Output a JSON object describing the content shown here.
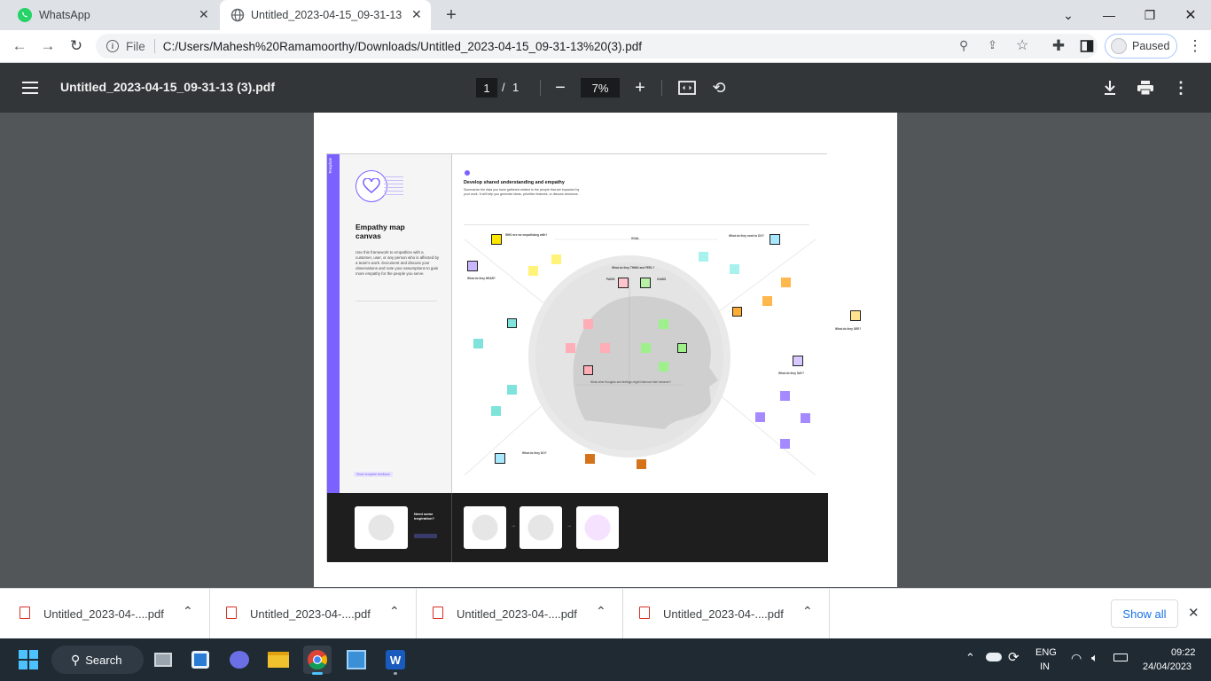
{
  "browser": {
    "tabs": [
      {
        "title": "WhatsApp",
        "icon": "whatsapp-icon"
      },
      {
        "title": "Untitled_2023-04-15_09-31-13 (3",
        "icon": "globe-icon"
      }
    ],
    "address": {
      "prefix": "File",
      "url": "C:/Users/Mahesh%20Ramamoorthy/Downloads/Untitled_2023-04-15_09-31-13%20(3).pdf"
    },
    "profile_label": "Paused"
  },
  "pdf": {
    "filename": "Untitled_2023-04-15_09-31-13 (3).pdf",
    "page_current": "1",
    "page_sep": "/",
    "page_total": "1",
    "zoom": "7%",
    "content": {
      "template_tag": "Template",
      "heading": "Empathy map canvas",
      "intro": "Use this framework to empathize with a customer, user, or any person who is affected by a team's work. Document and discuss your observations and note your assumptions to gain more empathy for the people you serve.",
      "share_link": "Share template feedback",
      "main_title": "Develop shared understanding and empathy",
      "main_sub": "Summarize the data you have gathered related to the people that are impacted by your work. It will help you generate ideas, prioritize features, or discuss decisions.",
      "goal": "GOAL",
      "who": "WHO are we empathizing with?",
      "think_feel": "What do they THINK and FEEL?",
      "pains": "PAINS",
      "gains": "GAINS",
      "hear": "What do they HEAR?",
      "see": "What do they SEE?",
      "say": "What do they SAY?",
      "do": "What do they DO?",
      "need": "What do they need to DO?",
      "other_thoughts": "What other thoughts and feelings might influence their behavior?",
      "inspiration": "Need some inspiration?"
    }
  },
  "downloads": {
    "items": [
      "Untitled_2023-04-....pdf",
      "Untitled_2023-04-....pdf",
      "Untitled_2023-04-....pdf",
      "Untitled_2023-04-....pdf"
    ],
    "show_all": "Show all"
  },
  "taskbar": {
    "search": "Search",
    "lang_top": "ENG",
    "lang_bottom": "IN",
    "time": "09:22",
    "date": "24/04/2023"
  }
}
